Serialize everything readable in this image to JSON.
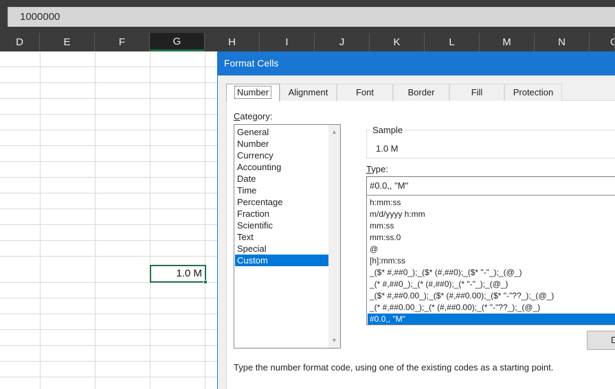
{
  "formula_bar": {
    "value": "1000000"
  },
  "columns": [
    "D",
    "E",
    "F",
    "G",
    "H",
    "I",
    "J",
    "K",
    "L",
    "M",
    "N",
    "O"
  ],
  "selected_column": "G",
  "active_cell": {
    "value": "1.0 M"
  },
  "dialog": {
    "title": "Format Cells",
    "tabs": [
      "Number",
      "Alignment",
      "Font",
      "Border",
      "Fill",
      "Protection"
    ],
    "active_tab": "Number",
    "category_label_prefix": "C",
    "category_label_rest": "ategory:",
    "categories": [
      "General",
      "Number",
      "Currency",
      "Accounting",
      "Date",
      "Time",
      "Percentage",
      "Fraction",
      "Scientific",
      "Text",
      "Special",
      "Custom"
    ],
    "selected_category": "Custom",
    "sample_label": "Sample",
    "sample_value": "1.0 M",
    "type_label_prefix": "T",
    "type_label_rest": "ype:",
    "type_value": "#0.0,, \"M\"",
    "type_list": [
      "h:mm:ss",
      "m/d/yyyy h:mm",
      "mm:ss",
      "mm:ss.0",
      "@",
      "[h]:mm:ss",
      "_($* #,##0_);_($* (#,##0);_($* \"-\"_);_(@_)",
      "_(* #,##0_);_(* (#,##0);_(* \"-\"_);_(@_)",
      "_($* #,##0.00_);_($* (#,##0.00);_($* \"-\"??_);_(@_)",
      "_(* #,##0.00_);_(* (#,##0.00);_(* \"-\"??_);_(@_)",
      "#0.0,, \"M\""
    ],
    "selected_type": "#0.0,, \"M\"",
    "delete_button_label": "D",
    "hint": "Type the number format code, using one of the existing codes as a starting point."
  }
}
